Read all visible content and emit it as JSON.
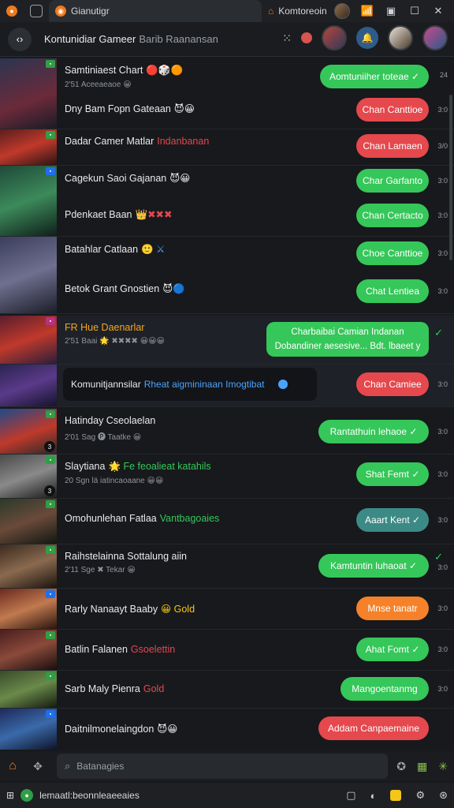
{
  "tabs": [
    {
      "label": "Gianutigr",
      "icon": "app-logo-icon"
    },
    {
      "label": "Komtoreoin",
      "icon": "home-icon"
    }
  ],
  "header": {
    "title": "Kontunidiar Gameer",
    "subtitle": "Barib Raanansan"
  },
  "rows": [
    {
      "name": "Samtiniaest Chart",
      "accent": "🔴🎲🟠",
      "sub": "2'51 Aceeaeaoe 😀",
      "action": "Aomtuniiher toteae ✓",
      "color": "green",
      "time": "24"
    },
    {
      "name": "Dny Bam Fopn Gateaan",
      "accent": "😈😀",
      "sub": "",
      "action": "Chan Canttioe",
      "color": "red",
      "time": "3:0"
    },
    {
      "name": "Dadar Camer Matlar",
      "accent": "Indanbanan",
      "sub": "",
      "action": "Chan Lamaen",
      "color": "red",
      "time": "3/0"
    },
    {
      "name": "Cagekun Saoi Gajanan",
      "accent": "😈😀",
      "sub": "",
      "action": "Char Garfanto",
      "color": "green",
      "time": "3:0"
    },
    {
      "name": "Pdenkaet Baan",
      "accent": "👑✖✖✖",
      "sub": "",
      "action": "Chan Certacto",
      "color": "green",
      "time": "3:0"
    },
    {
      "name": "Batahlar Catlaan",
      "accent": "🙂 ⚔",
      "sub": "",
      "action": "Choe Canttioe",
      "color": "green",
      "time": "3:0"
    },
    {
      "name": "Betok Grant Gnostien",
      "accent": "😈🔵",
      "sub": "",
      "action": "Chat Lentiea",
      "color": "green",
      "time": "3:0"
    },
    {
      "name": "FR Hue Daenarlar",
      "accent": "",
      "sub": "2'51 Baai 🌟 ✖✖✖✖ 😀😀😀",
      "action": "Charbaibai Camian Indanan",
      "action2": "Dobandiner aesesive... Bdt. lbaeet y",
      "color": "green",
      "time": ""
    },
    {
      "name": "Komunitjannsilar",
      "accent": "Rheat aigmininaan Imogtibat",
      "sub": "",
      "action": "Chan Camiee",
      "color": "red",
      "time": "3:0"
    },
    {
      "name": "Hatinday Cseolaelan",
      "accent": "",
      "sub": "2'01 Sag 🅟 Taatke 😀",
      "action": "Rantathuin lehaoe ✓",
      "color": "green",
      "time": "3:0"
    },
    {
      "name": "Slaytiana",
      "accent": "🌟 Fe feoalieat katahils",
      "sub": "20 Sgn lä iatincaoaane 😀😀",
      "action": "Shat Femt ✓",
      "color": "green",
      "time": "3:0"
    },
    {
      "name": "Omohunlehan Fatlaa",
      "accent": "Vantbagoaies",
      "sub": "",
      "action": "Aaart Kent ✓",
      "color": "teal",
      "time": "3:0"
    },
    {
      "name": "Raihstelainna Sottalung aiin",
      "accent": "",
      "sub": "2'11 Sge ✖ Tekar 😀",
      "action": "Kamtuntin luhaoat ✓",
      "color": "green",
      "time": "3:0"
    },
    {
      "name": "Rarly Nanaayt Baaby",
      "accent": "😀 Gold",
      "sub": "",
      "action": "Mnse tanatr",
      "color": "orange",
      "time": "3:0"
    },
    {
      "name": "Batlin Falanen",
      "accent": "Gsoelettin",
      "sub": "",
      "action": "Ahat Fomt ✓",
      "color": "green",
      "time": "3:0"
    },
    {
      "name": "Sarb Maly Pienra",
      "accent": "Gold",
      "sub": "",
      "action": "Mangoentanmg",
      "color": "green",
      "time": "3:0"
    },
    {
      "name": "Daitnilmonelaingdon",
      "accent": "😈😀",
      "sub": "",
      "action": "Addam Canpaemaine",
      "color": "red",
      "time": ""
    }
  ],
  "search": {
    "placeholder": "Batanagies"
  },
  "status": {
    "text": "lemaatl:beonnleaeeaies"
  }
}
